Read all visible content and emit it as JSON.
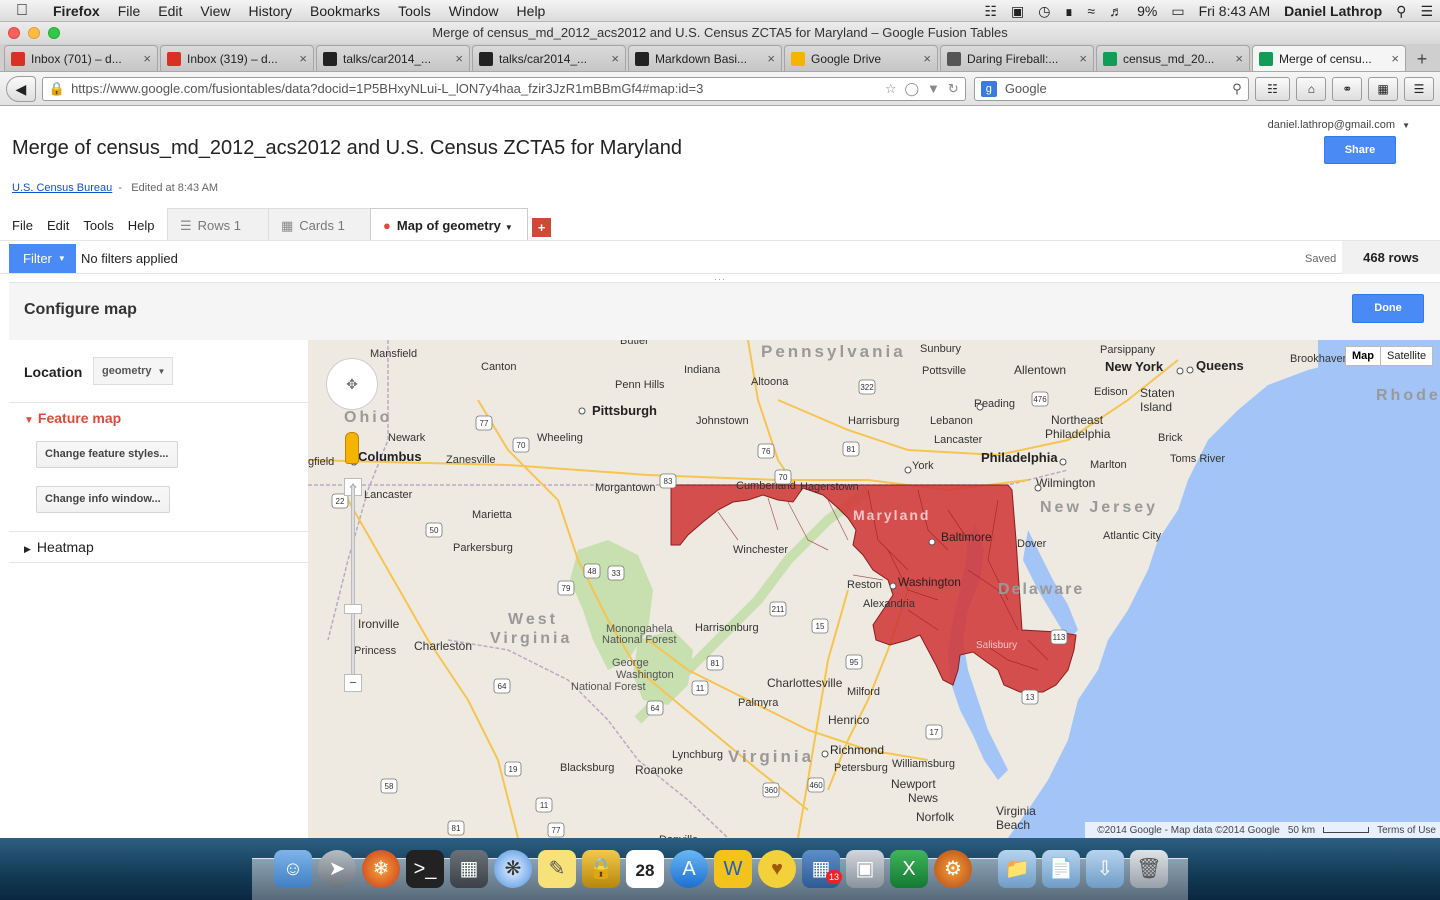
{
  "os_menubar": {
    "app_name": "Firefox",
    "menus": [
      "File",
      "Edit",
      "View",
      "History",
      "Bookmarks",
      "Tools",
      "Window",
      "Help"
    ],
    "battery": "9%",
    "clock": "Fri 8:43 AM",
    "user": "Daniel Lathrop"
  },
  "window": {
    "title": "Merge of census_md_2012_acs2012 and U.S. Census ZCTA5 for Maryland – Google Fusion Tables"
  },
  "browser_tabs": [
    {
      "label": "Inbox (701) – d...",
      "icon": "gmail-icon",
      "color": "#d93025"
    },
    {
      "label": "Inbox (319) – d...",
      "icon": "gmail-icon",
      "color": "#d93025"
    },
    {
      "label": "talks/car2014_...",
      "icon": "github-icon",
      "color": "#222222"
    },
    {
      "label": "talks/car2014_...",
      "icon": "github-icon",
      "color": "#222222"
    },
    {
      "label": "Markdown Basi...",
      "icon": "github-icon",
      "color": "#222222"
    },
    {
      "label": "Google Drive",
      "icon": "drive-icon",
      "color": "#f4b400"
    },
    {
      "label": "Daring Fireball:...",
      "icon": "star-icon",
      "color": "#555555"
    },
    {
      "label": "census_md_20...",
      "icon": "fusion-tables-icon",
      "color": "#0f9d58"
    },
    {
      "label": "Merge of censu...",
      "icon": "fusion-tables-icon",
      "color": "#0f9d58",
      "active": true
    }
  ],
  "navbar": {
    "url": "https://www.google.com/fusiontables/data?docid=1P5BHxyNLui-L_lON7y4haa_fzir3JzR1mBBmGf4#map:id=3",
    "search_placeholder": "Google"
  },
  "ft": {
    "title": "Merge of census_md_2012_acs2012 and U.S. Census ZCTA5 for Maryland",
    "account": "daniel.lathrop@gmail.com",
    "share_label": "Share",
    "source_link": "U.S. Census Bureau",
    "edited": "Edited at 8:43 AM",
    "menu": [
      "File",
      "Edit",
      "Tools",
      "Help"
    ],
    "tabs": [
      "Rows 1",
      "Cards 1",
      "Map of geometry"
    ],
    "add_tab": "+"
  },
  "filterbar": {
    "filter_label": "Filter",
    "status": "No filters applied",
    "saved": "Saved",
    "rows": "468 rows"
  },
  "config": {
    "title": "Configure map",
    "done_label": "Done",
    "location_label": "Location",
    "location_value": "geometry",
    "feature_map_label": "Feature map",
    "change_styles_label": "Change feature styles...",
    "change_info_label": "Change info window...",
    "heatmap_label": "Heatmap"
  },
  "map": {
    "type_map": "Map",
    "type_satellite": "Satellite",
    "attribution": "©2014 Google - Map data ©2014 Google",
    "scale": "50 km",
    "terms": "Terms of Use",
    "fill_color": "#d03838",
    "water_color": "#a3c4f7",
    "labels": {
      "pennsylvania": "Pennsylvania",
      "ohio": "Ohio",
      "west_virginia_1": "West",
      "west_virginia_2": "Virginia",
      "virginia": "Virginia",
      "new_jersey": "New Jersey",
      "delaware": "Delaware",
      "maryland": "Maryland",
      "rhode": "Rhode",
      "pittsburgh": "Pittsburgh",
      "columbus": "Columbus",
      "philadelphia": "Philadelphia",
      "new_york": "New York",
      "queens": "Queens",
      "baltimore": "Baltimore",
      "washington": "Washington",
      "richmond": "Richmond",
      "harrisburg": "Harrisburg",
      "wilmington": "Wilmington",
      "allentown": "Allentown",
      "reading": "Reading",
      "lancaster_pa": "Lancaster",
      "york": "York",
      "charleston": "Charleston",
      "morgantown": "Morgantown",
      "wheeling": "Wheeling",
      "canton": "Canton",
      "mansfield": "Mansfield",
      "newark": "Newark",
      "zanesville": "Zanesville",
      "lancaster_oh": "Lancaster",
      "marietta": "Marietta",
      "parkersburg": "Parkersburg",
      "ironville": "Ironville",
      "princess": "Princess",
      "winchester": "Winchester",
      "harrisonburg": "Harrisonburg",
      "charlottesville": "Charlottesville",
      "lynchburg": "Lynchburg",
      "roanoke": "Roanoke",
      "blacksburg": "Blacksburg",
      "danville": "Danville",
      "henrico": "Henrico",
      "petersburg": "Petersburg",
      "williamsburg": "Williamsburg",
      "newport_news_1": "Newport",
      "newport_news_2": "News",
      "norfolk": "Norfolk",
      "virginia_beach_1": "Virginia",
      "virginia_beach_2": "Beach",
      "palmyra": "Palmyra",
      "milford": "Milford",
      "reston": "Reston",
      "alexandria": "Alexandria",
      "dover": "Dover",
      "atlantic_city": "Atlantic City",
      "toms_river": "Toms River",
      "brick": "Brick",
      "marlton": "Marlton",
      "edison": "Edison",
      "staten_island_1": "Staten",
      "staten_island_2": "Island",
      "brookhaven": "Brookhaven",
      "parsippany": "Parsippany",
      "sunbury": "Sunbury",
      "pottsville": "Pottsville",
      "lebanon": "Lebanon",
      "johnstown": "Johnstown",
      "altoona": "Altoona",
      "indiana": "Indiana",
      "penn_hills": "Penn Hills",
      "butler": "Butler",
      "cumberland": "Cumberland",
      "hagerstown": "Hagerstown",
      "monongahela_1": "Monongahela",
      "monongahela_2": "National Forest",
      "gw_forest_1": "George",
      "gw_forest_2": "Washington",
      "gw_forest_3": "National Forest",
      "salisbury": "Salisbury",
      "northeast_philadelphia_1": "Northeast",
      "northeast_philadelphia_2": "Philadelphia",
      "springfield": "gfield"
    },
    "shields": [
      "77",
      "70",
      "76",
      "81",
      "83",
      "476",
      "322",
      "22",
      "50",
      "48",
      "33",
      "79",
      "211",
      "15",
      "95",
      "81",
      "64",
      "11",
      "64",
      "17",
      "19",
      "13",
      "360",
      "460",
      "58",
      "11",
      "81",
      "77",
      "113",
      "70"
    ]
  },
  "dock": {
    "calendar_day": "28",
    "calendar_month": "FEB",
    "badge": "13"
  }
}
